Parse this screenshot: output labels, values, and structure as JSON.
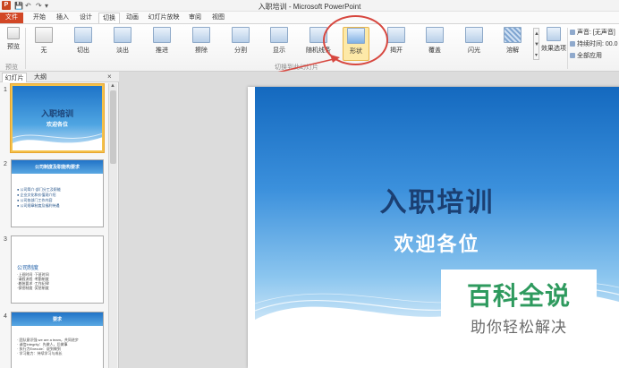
{
  "window": {
    "title": "入职培训 - Microsoft PowerPoint",
    "app_icon": "P",
    "quick_access": [
      "save-icon",
      "undo-icon",
      "redo-icon"
    ]
  },
  "ribbon_tabs": [
    {
      "label": "文件"
    },
    {
      "label": "开始"
    },
    {
      "label": "插入"
    },
    {
      "label": "设计"
    },
    {
      "label": "切换"
    },
    {
      "label": "动画"
    },
    {
      "label": "幻灯片放映"
    },
    {
      "label": "审阅"
    },
    {
      "label": "视图"
    }
  ],
  "active_tab": "切换",
  "preview": {
    "label": "预览",
    "group_label": "预览"
  },
  "transitions": {
    "group_label": "切换到此幻灯片",
    "items": [
      {
        "label": "无"
      },
      {
        "label": "切出"
      },
      {
        "label": "淡出"
      },
      {
        "label": "推进"
      },
      {
        "label": "擦除"
      },
      {
        "label": "分割"
      },
      {
        "label": "显示"
      },
      {
        "label": "随机线条"
      },
      {
        "label": "形状"
      },
      {
        "label": "揭开"
      },
      {
        "label": "覆盖"
      },
      {
        "label": "闪光"
      },
      {
        "label": "溶解"
      }
    ],
    "selected": "形状"
  },
  "effect_options": {
    "label": "效果选项"
  },
  "timing": {
    "sound": "声音: [无声音]",
    "duration": "持续时间: 00.0",
    "apply_all": "全部应用"
  },
  "slide_pane": {
    "tabs": [
      {
        "label": "幻灯片"
      },
      {
        "label": "大纲"
      }
    ],
    "close": "×",
    "slides": [
      {
        "number": "1",
        "title": "入职培训",
        "subtitle": "欢迎各位"
      },
      {
        "number": "2",
        "title": "公司制度及职能构要求",
        "bullets": [
          "● 公司简介·部门分工及职能",
          "● 企业文化和价值观介绍",
          "● 公司各部门工作内容",
          "● 公司规章制度及福利待遇"
        ]
      },
      {
        "number": "3",
        "title": "公司制度",
        "body": [
          "·上班时间  ·下班时间",
          "·请假流程  ·考勤制度",
          "·着装要求  ·工作纪律",
          "·保密制度  ·奖惩制度"
        ]
      },
      {
        "number": "4",
        "title": "要求",
        "body": [
          "· 团队意识强 we are a team，共同进步",
          "· 诚信Integrity：先做人，后做事",
          "· 执行力Execute：说到做到",
          "· 学习能力：持续学习与成长"
        ]
      }
    ]
  },
  "main_slide": {
    "title": "入职培训",
    "subtitle": "欢迎各位"
  },
  "watermark": {
    "main": "百科全说",
    "sub": "助你轻松解决"
  },
  "colors": {
    "accent": "#d24726",
    "highlight": "#fde9a8",
    "annotation": "#d7473f"
  }
}
